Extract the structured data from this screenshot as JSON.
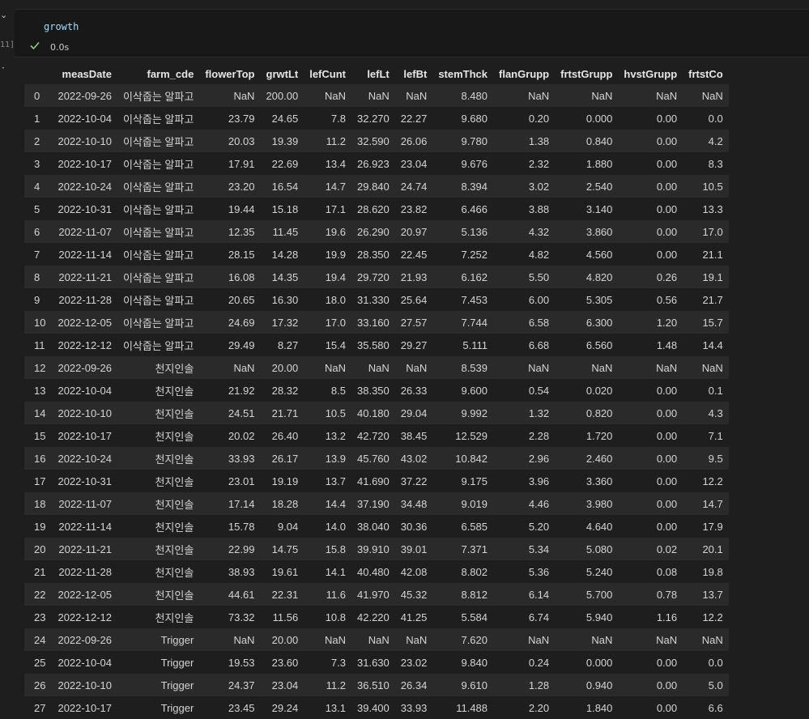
{
  "cell": {
    "execution_count": "11]",
    "code": "growth",
    "status_time": "0.0s"
  },
  "table": {
    "columns": [
      "measDate",
      "farm_cde",
      "flowerTop",
      "grwtLt",
      "lefCunt",
      "lefLt",
      "lefBt",
      "stemThck",
      "flanGrupp",
      "frtstGrupp",
      "hvstGrupp",
      "frtstCo"
    ],
    "rows": [
      [
        "0",
        "2022-09-26",
        "이삭줍는 알파고",
        "NaN",
        "200.00",
        "NaN",
        "NaN",
        "NaN",
        "8.480",
        "NaN",
        "NaN",
        "NaN",
        "NaN"
      ],
      [
        "1",
        "2022-10-04",
        "이삭줍는 알파고",
        "23.79",
        "24.65",
        "7.8",
        "32.270",
        "22.27",
        "9.680",
        "0.20",
        "0.000",
        "0.00",
        "0.0"
      ],
      [
        "2",
        "2022-10-10",
        "이삭줍는 알파고",
        "20.03",
        "19.39",
        "11.2",
        "32.590",
        "26.06",
        "9.780",
        "1.38",
        "0.840",
        "0.00",
        "4.2"
      ],
      [
        "3",
        "2022-10-17",
        "이삭줍는 알파고",
        "17.91",
        "22.69",
        "13.4",
        "26.923",
        "23.04",
        "9.676",
        "2.32",
        "1.880",
        "0.00",
        "8.3"
      ],
      [
        "4",
        "2022-10-24",
        "이삭줍는 알파고",
        "23.20",
        "16.54",
        "14.7",
        "29.840",
        "24.74",
        "8.394",
        "3.02",
        "2.540",
        "0.00",
        "10.5"
      ],
      [
        "5",
        "2022-10-31",
        "이삭줍는 알파고",
        "19.44",
        "15.18",
        "17.1",
        "28.620",
        "23.82",
        "6.466",
        "3.88",
        "3.140",
        "0.00",
        "13.3"
      ],
      [
        "6",
        "2022-11-07",
        "이삭줍는 알파고",
        "12.35",
        "11.45",
        "19.6",
        "26.290",
        "20.97",
        "5.136",
        "4.32",
        "3.860",
        "0.00",
        "17.0"
      ],
      [
        "7",
        "2022-11-14",
        "이삭줍는 알파고",
        "28.15",
        "14.28",
        "19.9",
        "28.350",
        "22.45",
        "7.252",
        "4.82",
        "4.560",
        "0.00",
        "21.1"
      ],
      [
        "8",
        "2022-11-21",
        "이삭줍는 알파고",
        "16.08",
        "14.35",
        "19.4",
        "29.720",
        "21.93",
        "6.162",
        "5.50",
        "4.820",
        "0.26",
        "19.1"
      ],
      [
        "9",
        "2022-11-28",
        "이삭줍는 알파고",
        "20.65",
        "16.30",
        "18.0",
        "31.330",
        "25.64",
        "7.453",
        "6.00",
        "5.305",
        "0.56",
        "21.7"
      ],
      [
        "10",
        "2022-12-05",
        "이삭줍는 알파고",
        "24.69",
        "17.32",
        "17.0",
        "33.160",
        "27.57",
        "7.744",
        "6.58",
        "6.300",
        "1.20",
        "15.7"
      ],
      [
        "11",
        "2022-12-12",
        "이삭줍는 알파고",
        "29.49",
        "8.27",
        "15.4",
        "35.580",
        "29.27",
        "5.111",
        "6.68",
        "6.560",
        "1.48",
        "14.4"
      ],
      [
        "12",
        "2022-09-26",
        "천지인솔",
        "NaN",
        "20.00",
        "NaN",
        "NaN",
        "NaN",
        "8.539",
        "NaN",
        "NaN",
        "NaN",
        "NaN"
      ],
      [
        "13",
        "2022-10-04",
        "천지인솔",
        "21.92",
        "28.32",
        "8.5",
        "38.350",
        "26.33",
        "9.600",
        "0.54",
        "0.020",
        "0.00",
        "0.1"
      ],
      [
        "14",
        "2022-10-10",
        "천지인솔",
        "24.51",
        "21.71",
        "10.5",
        "40.180",
        "29.04",
        "9.992",
        "1.32",
        "0.820",
        "0.00",
        "4.3"
      ],
      [
        "15",
        "2022-10-17",
        "천지인솔",
        "20.02",
        "26.40",
        "13.2",
        "42.720",
        "38.45",
        "12.529",
        "2.28",
        "1.720",
        "0.00",
        "7.1"
      ],
      [
        "16",
        "2022-10-24",
        "천지인솔",
        "33.93",
        "26.17",
        "13.9",
        "45.760",
        "43.02",
        "10.842",
        "2.96",
        "2.460",
        "0.00",
        "9.5"
      ],
      [
        "17",
        "2022-10-31",
        "천지인솔",
        "23.01",
        "19.19",
        "13.7",
        "41.690",
        "37.22",
        "9.175",
        "3.96",
        "3.360",
        "0.00",
        "12.2"
      ],
      [
        "18",
        "2022-11-07",
        "천지인솔",
        "17.14",
        "18.28",
        "14.4",
        "37.190",
        "34.48",
        "9.019",
        "4.46",
        "3.980",
        "0.00",
        "14.7"
      ],
      [
        "19",
        "2022-11-14",
        "천지인솔",
        "15.78",
        "9.04",
        "14.0",
        "38.040",
        "30.36",
        "6.585",
        "5.20",
        "4.640",
        "0.00",
        "17.9"
      ],
      [
        "20",
        "2022-11-21",
        "천지인솔",
        "22.99",
        "14.75",
        "15.8",
        "39.910",
        "39.01",
        "7.371",
        "5.34",
        "5.080",
        "0.02",
        "20.1"
      ],
      [
        "21",
        "2022-11-28",
        "천지인솔",
        "38.93",
        "19.61",
        "14.1",
        "40.480",
        "42.08",
        "8.802",
        "5.36",
        "5.240",
        "0.08",
        "19.8"
      ],
      [
        "22",
        "2022-12-05",
        "천지인솔",
        "44.61",
        "22.31",
        "11.6",
        "41.970",
        "45.32",
        "8.812",
        "6.14",
        "5.700",
        "0.78",
        "13.7"
      ],
      [
        "23",
        "2022-12-12",
        "천지인솔",
        "73.32",
        "11.56",
        "10.8",
        "42.220",
        "41.25",
        "5.584",
        "6.74",
        "5.940",
        "1.16",
        "12.2"
      ],
      [
        "24",
        "2022-09-26",
        "Trigger",
        "NaN",
        "20.00",
        "NaN",
        "NaN",
        "NaN",
        "7.620",
        "NaN",
        "NaN",
        "NaN",
        "NaN"
      ],
      [
        "25",
        "2022-10-04",
        "Trigger",
        "19.53",
        "23.60",
        "7.3",
        "31.630",
        "23.02",
        "9.840",
        "0.24",
        "0.000",
        "0.00",
        "0.0"
      ],
      [
        "26",
        "2022-10-10",
        "Trigger",
        "24.37",
        "23.04",
        "11.2",
        "36.510",
        "26.34",
        "9.610",
        "1.28",
        "0.940",
        "0.00",
        "5.0"
      ],
      [
        "27",
        "2022-10-17",
        "Trigger",
        "23.45",
        "29.24",
        "13.1",
        "39.400",
        "33.93",
        "11.488",
        "2.20",
        "1.840",
        "0.00",
        "6.6"
      ]
    ]
  },
  "colors": {
    "background": "#1e1e1e",
    "editor": "#181818",
    "row_stripe": "#2a2a2a",
    "check": "#89d185",
    "code": "#9cdcfe"
  }
}
